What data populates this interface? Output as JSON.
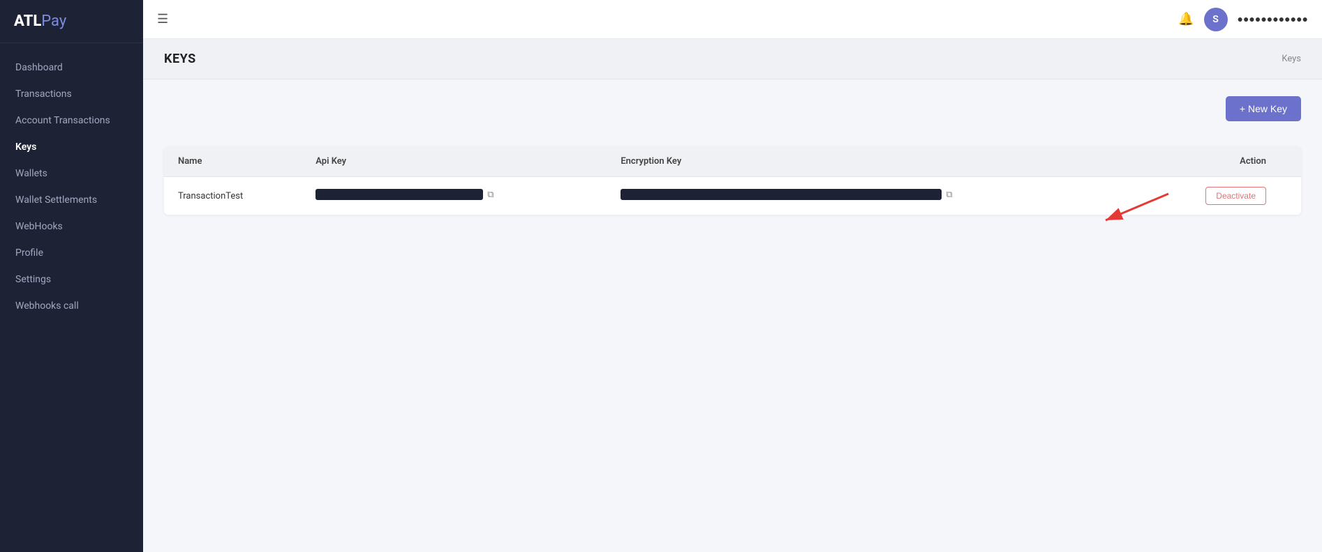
{
  "app": {
    "logo_atl": "ATL",
    "logo_pay": "Pay"
  },
  "sidebar": {
    "items": [
      {
        "label": "Dashboard",
        "key": "dashboard",
        "active": false
      },
      {
        "label": "Transactions",
        "key": "transactions",
        "active": false
      },
      {
        "label": "Account Transactions",
        "key": "account-transactions",
        "active": false
      },
      {
        "label": "Keys",
        "key": "keys",
        "active": true
      },
      {
        "label": "Wallets",
        "key": "wallets",
        "active": false
      },
      {
        "label": "Wallet Settlements",
        "key": "wallet-settlements",
        "active": false
      },
      {
        "label": "WebHooks",
        "key": "webhooks",
        "active": false
      },
      {
        "label": "Profile",
        "key": "profile",
        "active": false
      },
      {
        "label": "Settings",
        "key": "settings",
        "active": false
      },
      {
        "label": "Webhooks call",
        "key": "webhooks-call",
        "active": false
      }
    ]
  },
  "topbar": {
    "hamburger_label": "☰",
    "user_initial": "S",
    "user_name": "●●●●●●●●●●●●"
  },
  "page": {
    "title": "KEYS",
    "breadcrumb": "Keys",
    "new_key_label": "+ New Key"
  },
  "table": {
    "columns": [
      {
        "key": "name",
        "label": "Name"
      },
      {
        "key": "api_key",
        "label": "Api Key"
      },
      {
        "key": "encryption_key",
        "label": "Encryption Key"
      },
      {
        "key": "action",
        "label": "Action"
      }
    ],
    "rows": [
      {
        "name": "TransactionTest",
        "api_key_masked": true,
        "encryption_key_masked": true,
        "action": "Deactivate"
      }
    ]
  }
}
